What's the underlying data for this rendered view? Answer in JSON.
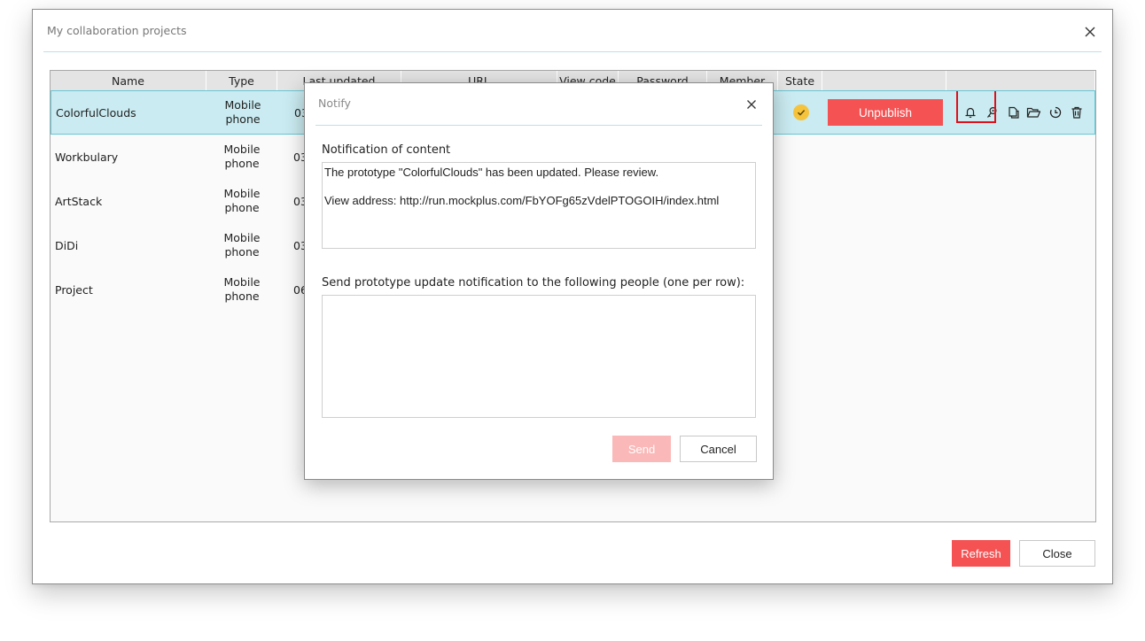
{
  "window": {
    "title": "My collaboration projects",
    "close_icon": "close-icon"
  },
  "table": {
    "columns": [
      "Name",
      "Type",
      "Last updated",
      "URL",
      "View code",
      "Password",
      "Member",
      "State",
      ""
    ],
    "rows": [
      {
        "name": "ColorfulClouds",
        "type": "Mobile phone",
        "date_prefix": "03",
        "selected": true
      },
      {
        "name": "Workbulary",
        "type": "Mobile phone",
        "date_prefix": "03"
      },
      {
        "name": "ArtStack",
        "type": "Mobile phone",
        "date_prefix": "03"
      },
      {
        "name": "DiDi",
        "type": "Mobile phone",
        "date_prefix": "03"
      },
      {
        "name": "Project",
        "type": "Mobile phone",
        "date_prefix": "06"
      }
    ],
    "selected_row": {
      "state_icon": "check-circle-icon",
      "action_label": "Unpublish",
      "tool_icons": [
        "bell-icon",
        "key-icon",
        "copy-icon",
        "folder-open-icon",
        "history-icon",
        "trash-icon"
      ]
    }
  },
  "footer": {
    "refresh_label": "Refresh",
    "close_label": "Close"
  },
  "notify": {
    "title": "Notify",
    "content_label": "Notification of content",
    "content_text": "The prototype \"ColorfulClouds\" has been updated. Please review.\n\nView address: http://run.mockplus.com/FbYOFg65zVdelPTOGOIH/index.html",
    "recipients_label": "Send prototype update notification to the following people (one per row):",
    "recipients_value": "",
    "send_label": "Send",
    "cancel_label": "Cancel"
  },
  "colors": {
    "accent_red": "#f55253",
    "selected_row": "#c9ebf1",
    "state_yellow": "#f6c33c",
    "highlight": "#e0101a"
  }
}
